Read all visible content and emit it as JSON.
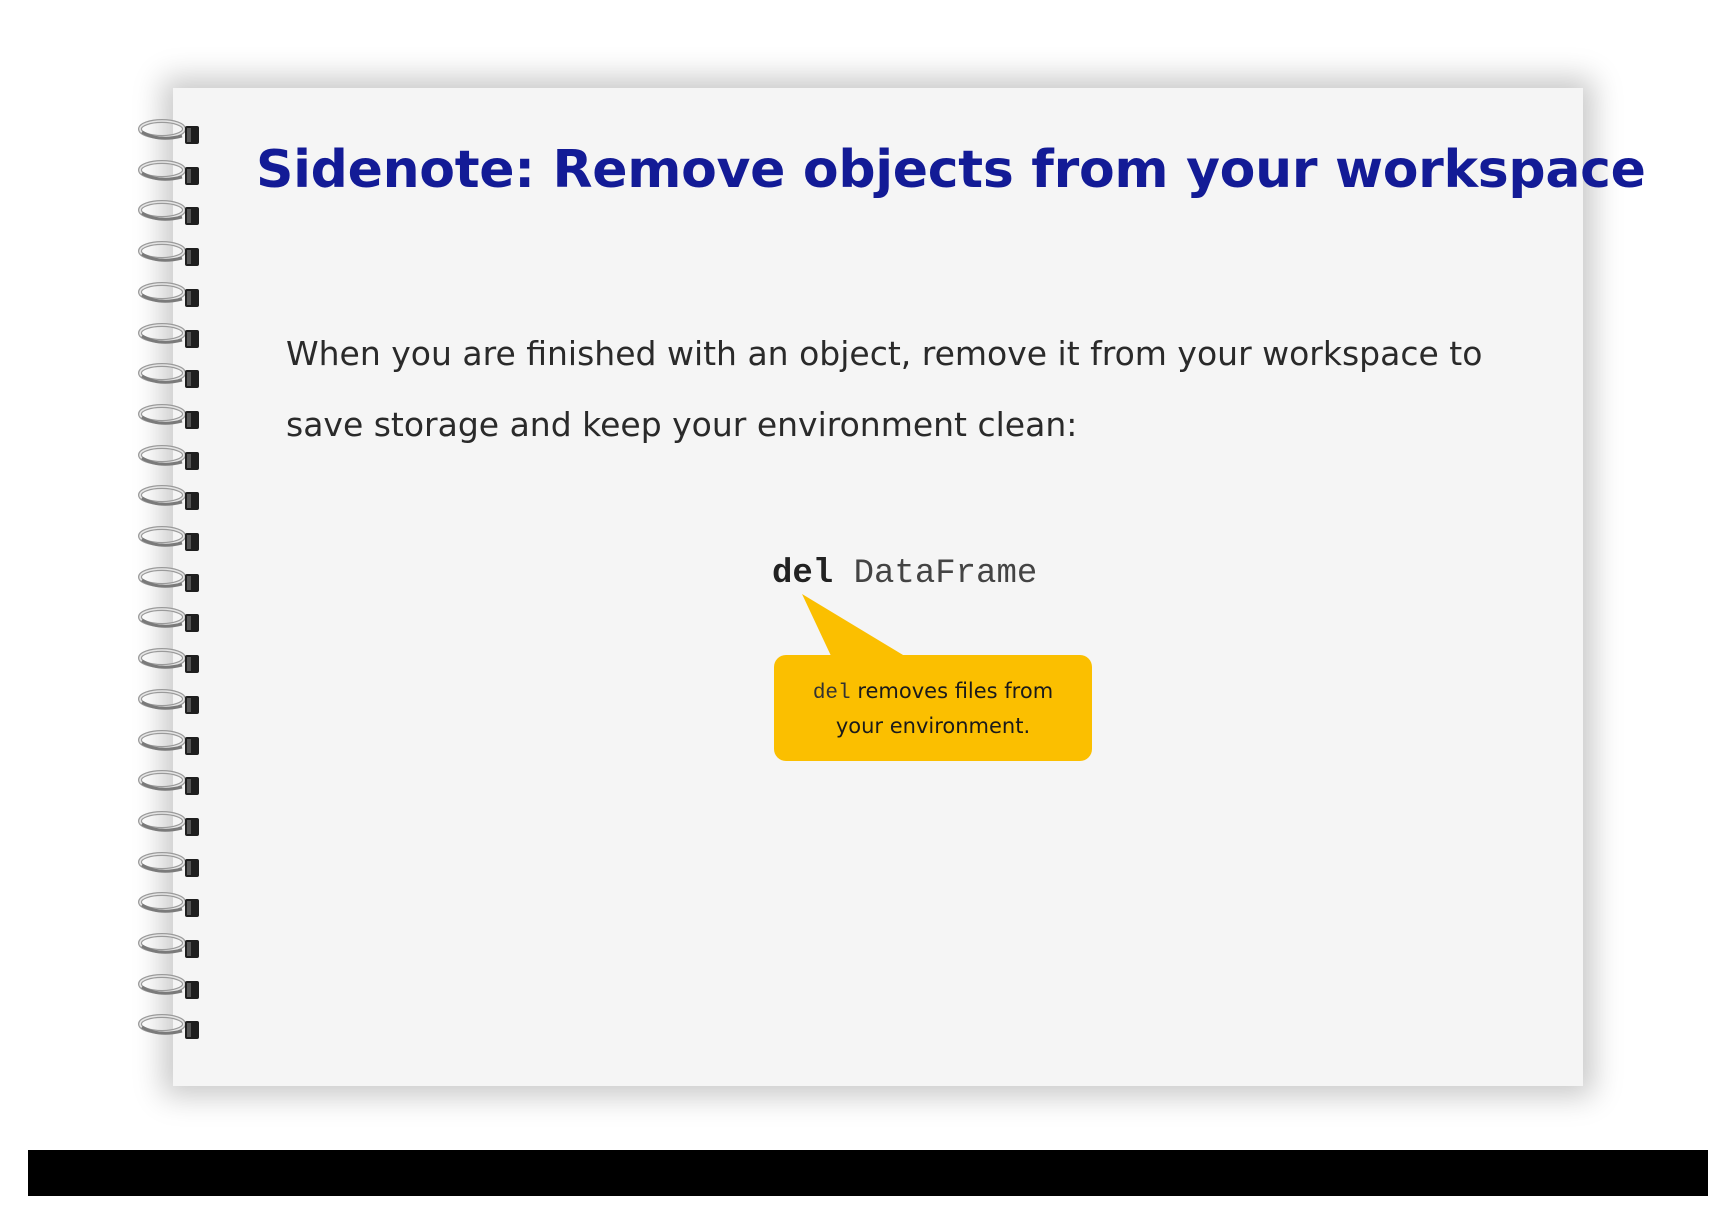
{
  "slide": {
    "title": "Sidenote: Remove objects from your workspace",
    "body_line1": "When you are finished with an object, remove it from your workspace to",
    "body_line2": "save storage and keep your environment clean:"
  },
  "code": {
    "keyword": "del",
    "argument": "DataFrame"
  },
  "callout": {
    "code": "del",
    "text_line1": "removes files from",
    "text_line2": "your environment."
  },
  "colors": {
    "title": "#131b96",
    "callout": "#fbbf00",
    "page": "#f5f5f5",
    "footer": "#000000"
  },
  "spiral_rings": 23
}
